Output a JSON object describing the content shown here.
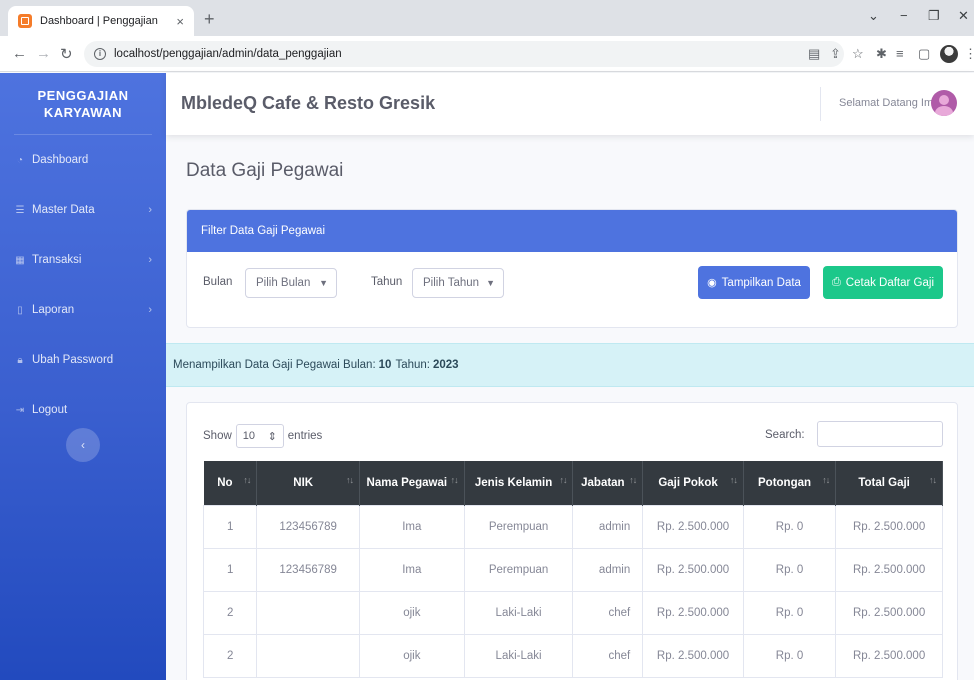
{
  "browser": {
    "tab_title": "Dashboard | Penggajian",
    "tab_close": "×",
    "new_tab": "+",
    "url_host": "localhost",
    "url_path": "/penggajian/admin/data_penggajian",
    "win_min": "−",
    "win_max": "❐",
    "win_close": "✕",
    "win_dropdown": "⌄"
  },
  "sidebar": {
    "brand_line1": "PENGGAJIAN",
    "brand_line2": "KARYAWAN",
    "items": [
      {
        "label": "Dashboard",
        "icon": "dashboard-icon",
        "chevron": ""
      },
      {
        "label": "Master Data",
        "icon": "database-icon",
        "chevron": "›"
      },
      {
        "label": "Transaksi",
        "icon": "table-icon",
        "chevron": "›"
      },
      {
        "label": "Laporan",
        "icon": "file-icon",
        "chevron": "›"
      },
      {
        "label": "Ubah Password",
        "icon": "lock-icon",
        "chevron": ""
      },
      {
        "label": "Logout",
        "icon": "logout-icon",
        "chevron": ""
      }
    ],
    "toggle_glyph": "‹"
  },
  "topbar": {
    "app_title": "MbledeQ Cafe & Resto Gresik",
    "greeting": "Selamat Datang Ima"
  },
  "page": {
    "title": "Data Gaji Pegawai"
  },
  "filter": {
    "header": "Filter Data Gaji Pegawai",
    "bulan_label": "Bulan",
    "bulan_value": "Pilih Bulan",
    "tahun_label": "Tahun",
    "tahun_value": "Pilih Tahun",
    "show_button": "Tampilkan Data",
    "print_button": "Cetak Daftar Gaji"
  },
  "alert": {
    "text": "Menampilkan Data Gaji Pegawai Bulan:",
    "bulan": "10",
    "tahun_text": "Tahun:",
    "tahun": "2023"
  },
  "table": {
    "show_label": "Show",
    "entries_value": "10",
    "entries_label": "entries",
    "search_label": "Search:",
    "columns": [
      "No",
      "NIK",
      "Nama Pegawai",
      "Jenis Kelamin",
      "Jabatan",
      "Gaji Pokok",
      "Potongan",
      "Total Gaji"
    ],
    "rows": [
      [
        "1",
        "123456789",
        "Ima",
        "Perempuan",
        "admin",
        "Rp. 2.500.000",
        "Rp. 0",
        "Rp. 2.500.000"
      ],
      [
        "1",
        "123456789",
        "Ima",
        "Perempuan",
        "admin",
        "Rp. 2.500.000",
        "Rp. 0",
        "Rp. 2.500.000"
      ],
      [
        "2",
        "",
        "ojik",
        "Laki-Laki",
        "chef",
        "Rp. 2.500.000",
        "Rp. 0",
        "Rp. 2.500.000"
      ],
      [
        "2",
        "",
        "ojik",
        "Laki-Laki",
        "chef",
        "Rp. 2.500.000",
        "Rp. 0",
        "Rp. 2.500.000"
      ]
    ]
  }
}
